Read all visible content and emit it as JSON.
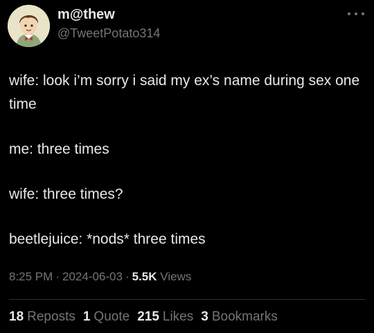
{
  "author": {
    "display_name": "m@thew",
    "handle": "@TweetPotato314",
    "avatar": "avatar-cartoon-boy"
  },
  "more_icon": "more-horizontal-icon",
  "tweet": {
    "lines": [
      "wife: look i’m sorry i said my ex’s name during sex one time",
      "me: three times",
      "wife: three times?",
      "beetlejuice: *nods* three times"
    ]
  },
  "meta": {
    "time": "8:25 PM",
    "date": "2024-06-03",
    "separator": "·",
    "views_count": "5.5K",
    "views_label": "Views"
  },
  "stats": [
    {
      "count": "18",
      "label": "Reposts"
    },
    {
      "count": "1",
      "label": "Quote"
    },
    {
      "count": "215",
      "label": "Likes"
    },
    {
      "count": "3",
      "label": "Bookmarks"
    }
  ],
  "colors": {
    "background": "#000000",
    "primary_text": "#e7e9ea",
    "secondary_text": "#71767b",
    "divider": "#2f3336"
  }
}
